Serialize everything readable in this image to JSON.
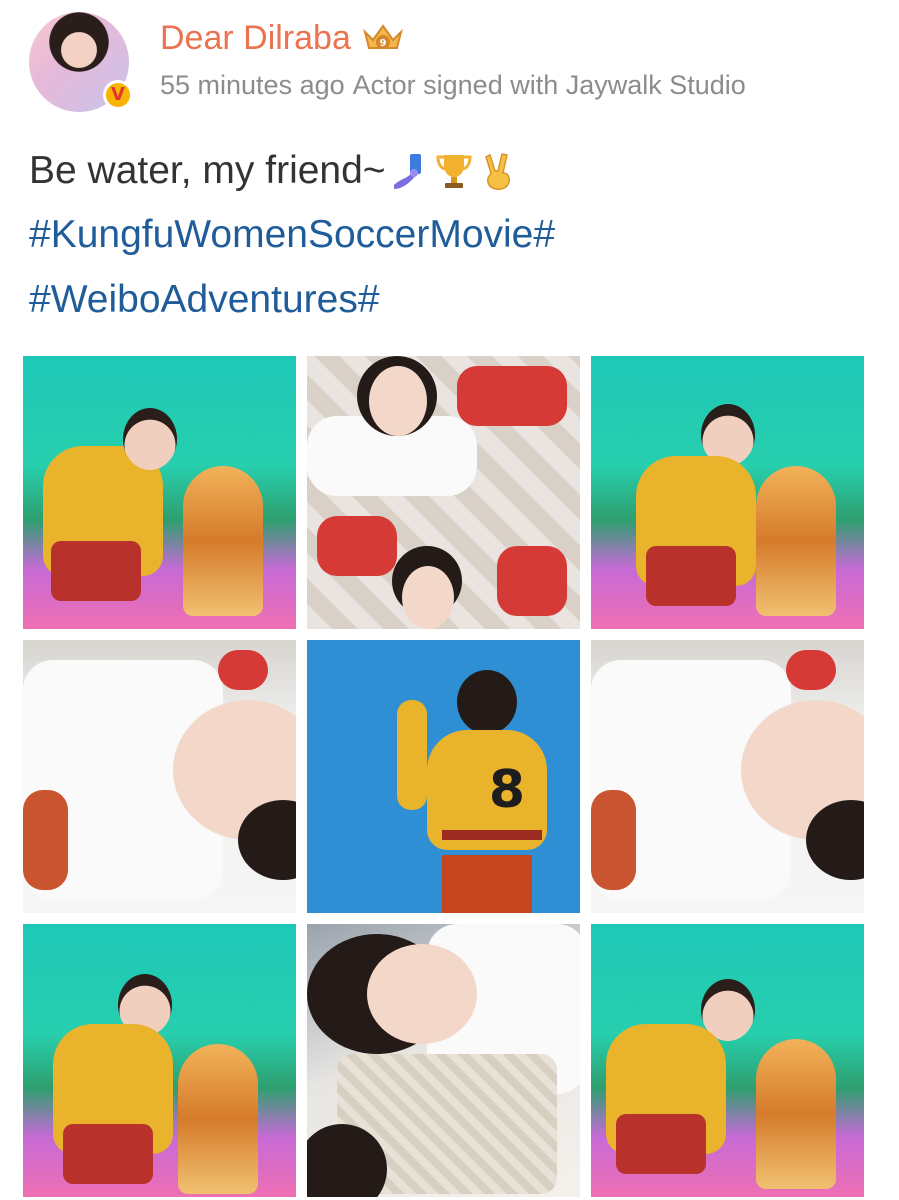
{
  "post": {
    "author": "Dear Dilraba",
    "time": "55 minutes ago",
    "source": "Actor signed with Jaywalk Studio",
    "text": "Be water, my friend~",
    "emojis": [
      "selfie-icon",
      "trophy-icon",
      "victory-hand-icon"
    ],
    "hashtags": [
      "#KungfuWomenSoccerMovie#",
      "#WeiboAdventures#"
    ],
    "verified_badge": "V",
    "crown_badge_number": "9"
  },
  "colors": {
    "author": "#eb7350",
    "meta": "#8c8c8c",
    "text": "#333333",
    "hashtag": "#1f5c99",
    "background": "#ffffff"
  },
  "photos": [
    {
      "scene": "trophy-green-screen"
    },
    {
      "scene": "selfie-on-floor"
    },
    {
      "scene": "trophy-green-screen"
    },
    {
      "scene": "lying-selfie"
    },
    {
      "scene": "blue-backdrop-jersey",
      "jersey_number": "8"
    },
    {
      "scene": "lying-selfie"
    },
    {
      "scene": "trophy-green-screen"
    },
    {
      "scene": "pillow-selfie"
    },
    {
      "scene": "trophy-green-screen"
    }
  ]
}
